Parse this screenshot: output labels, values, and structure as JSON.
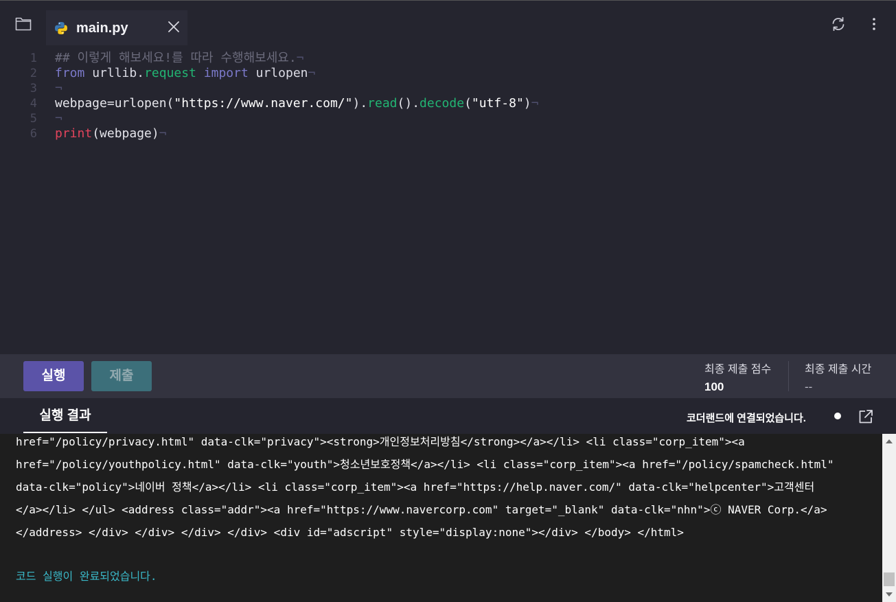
{
  "tab": {
    "filename": "main.py"
  },
  "editor": {
    "lines": [
      {
        "num": "1",
        "parts": [
          {
            "t": "## 이렇게 해보세요!를 따라 수행해보세요.",
            "c": "cmt"
          },
          {
            "t": "¬",
            "c": "nl"
          }
        ]
      },
      {
        "num": "2",
        "parts": [
          {
            "t": "from",
            "c": "kw"
          },
          {
            "t": " urllib.",
            "c": "mod"
          },
          {
            "t": "request",
            "c": "attr"
          },
          {
            "t": " ",
            "c": "pl"
          },
          {
            "t": "import",
            "c": "kw"
          },
          {
            "t": " urlopen",
            "c": "mod"
          },
          {
            "t": "¬",
            "c": "nl"
          }
        ]
      },
      {
        "num": "3",
        "parts": [
          {
            "t": "¬",
            "c": "nl"
          }
        ]
      },
      {
        "num": "4",
        "parts": [
          {
            "t": "webpage=urlopen(",
            "c": "pl"
          },
          {
            "t": "\"https://www.naver.com/\"",
            "c": "str"
          },
          {
            "t": ").",
            "c": "pl"
          },
          {
            "t": "read",
            "c": "attr"
          },
          {
            "t": "().",
            "c": "pl"
          },
          {
            "t": "decode",
            "c": "attr"
          },
          {
            "t": "(",
            "c": "pl"
          },
          {
            "t": "\"utf-8\"",
            "c": "str"
          },
          {
            "t": ")",
            "c": "pl"
          },
          {
            "t": "¬",
            "c": "nl"
          }
        ]
      },
      {
        "num": "5",
        "parts": [
          {
            "t": "¬",
            "c": "nl"
          }
        ]
      },
      {
        "num": "6",
        "parts": [
          {
            "t": "print",
            "c": "fn"
          },
          {
            "t": "(webpage)",
            "c": "pl"
          },
          {
            "t": "¬",
            "c": "nl"
          }
        ]
      }
    ]
  },
  "toolbar": {
    "run_label": "실행",
    "submit_label": "제출",
    "score_label": "최종 제출 점수",
    "score_value": "100",
    "time_label": "최종 제출 시간",
    "time_value": "--"
  },
  "output": {
    "tab_label": "실행 결과",
    "connection_status": "코더랜드에 연결되었습니다.",
    "lines": [
      "href=\"/policy/privacy.html\" data-clk=\"privacy\"><strong>개인정보처리방침</strong></a></li> <li class=\"corp_item\"><a",
      "href=\"/policy/youthpolicy.html\" data-clk=\"youth\">청소년보호정책</a></li> <li class=\"corp_item\"><a href=\"/policy/spamcheck.html\"",
      "data-clk=\"policy\">네이버 정책</a></li> <li class=\"corp_item\"><a href=\"https://help.naver.com/\" data-clk=\"helpcenter\">고객센터",
      "</a></li> </ul> <address class=\"addr\"><a href=\"https://www.navercorp.com\" target=\"_blank\" data-clk=\"nhn\">ⓒ NAVER Corp.</a>",
      "</address> </div> </div> </div> </div> <div id=\"adscript\" style=\"display:none\"></div> </body> </html>"
    ],
    "done_message": "코드 실행이 완료되었습니다."
  },
  "icons": {
    "folder": "folder-icon",
    "python": "python-icon",
    "close": "close-icon",
    "refresh": "refresh-icon",
    "more": "more-vertical-icon",
    "external": "external-link-icon"
  },
  "colors": {
    "run_button": "#5b53a8",
    "submit_button": "#3c6f7a",
    "keyword": "#7b79c9",
    "attribute": "#22b573",
    "function": "#e2445c",
    "done_message": "#3ab8c8"
  }
}
